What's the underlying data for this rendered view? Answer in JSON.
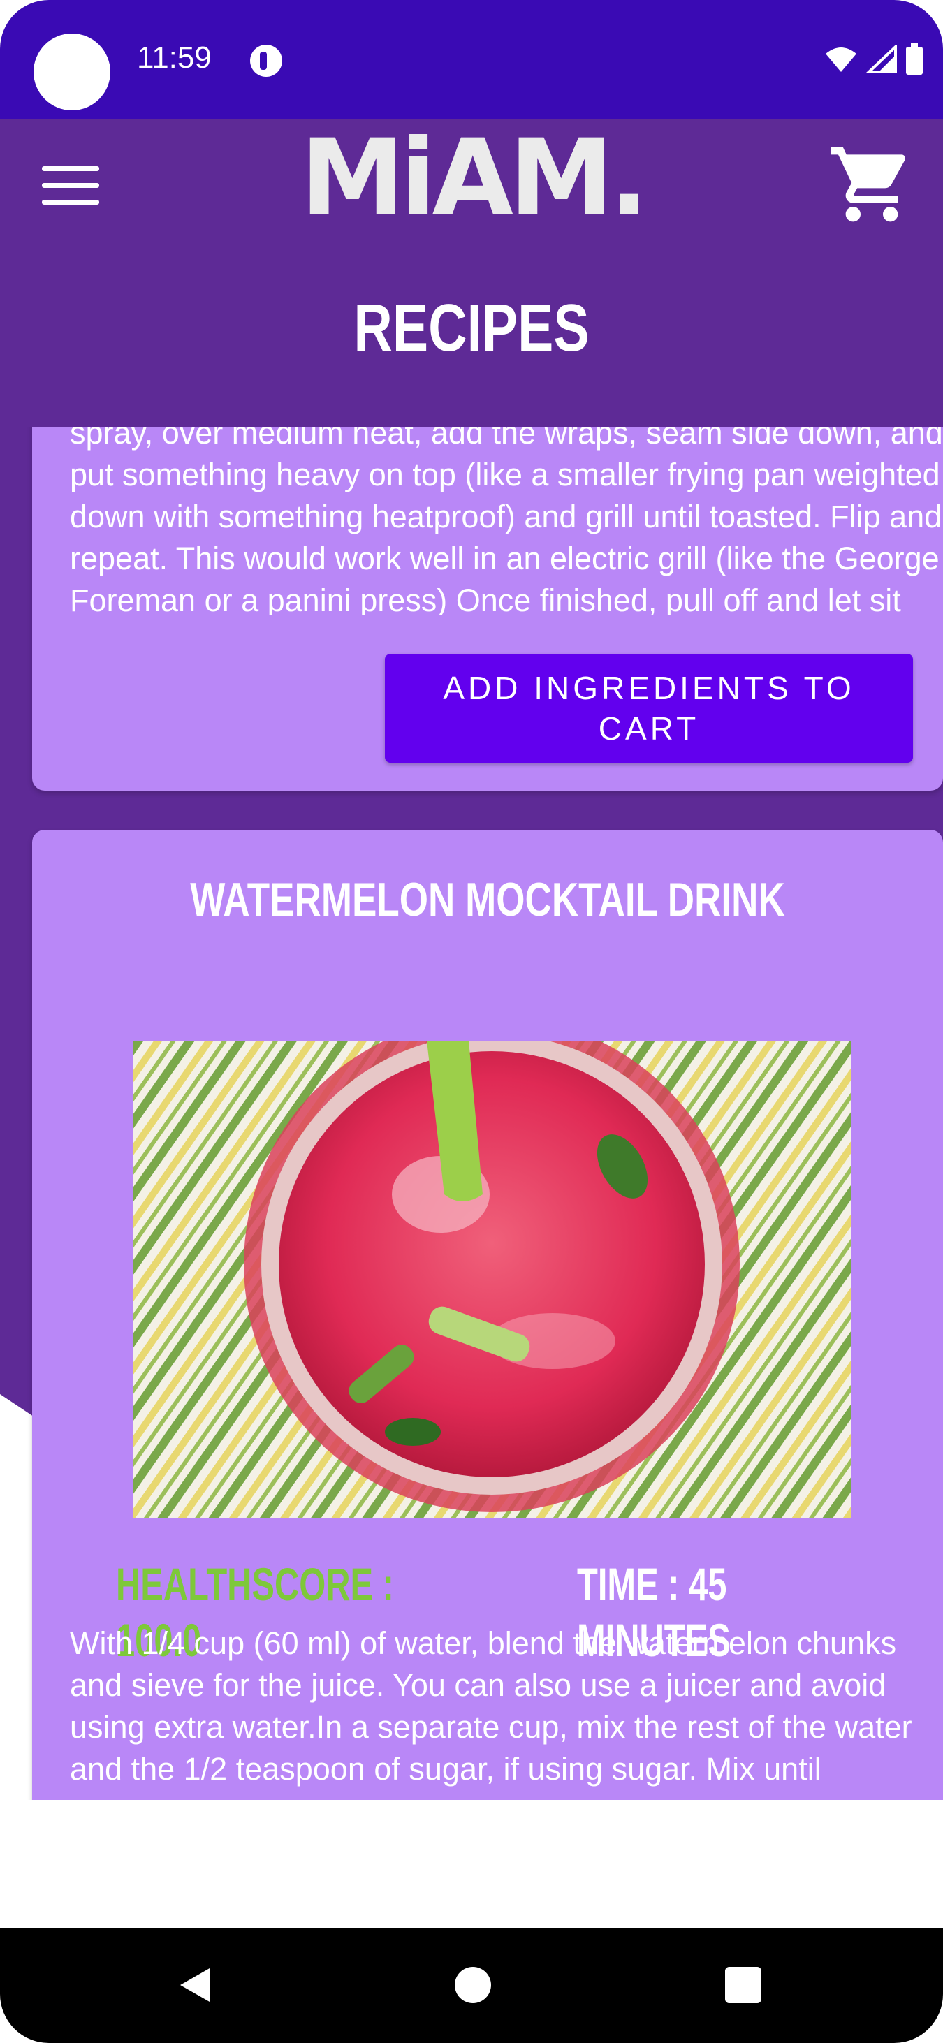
{
  "status_bar": {
    "time": "11:59",
    "icons": [
      "wifi-icon",
      "signal-icon",
      "battery-icon"
    ]
  },
  "header": {
    "logo_text": "MiAM.",
    "title": "RECIPES",
    "menu_icon": "hamburger-menu-icon",
    "cart_icon": "shopping-cart-icon"
  },
  "recipes": [
    {
      "instructions": "spray, over medium heat, add the wraps, seam side down, and put something heavy on top (like a smaller frying pan weighted down with something heatproof) and grill until toasted. Flip and repeat. This would work well in an electric grill (like the George Foreman or a panini press) Once finished, pull off and let sit for",
      "button_label": "ADD  INGREDIENTS TO CART"
    },
    {
      "title": "WATERMELON MOCKTAIL DRINK",
      "image_label": "watermelon mocktail photo",
      "healthscore": "HEALTHSCORE : 100.0",
      "time": "TIME : 45 MINUTES",
      "instructions": "With 1/4 cup (60 ml) of water, blend the watermelon chunks and sieve for the juice. You can also use a juicer and avoid using extra water.In a separate cup, mix the rest of the water and the 1/2 teaspoon of sugar, if using sugar. Mix until"
    }
  ],
  "colors": {
    "status_bar": "#3a0ab4",
    "header": "#5e2a96",
    "card": "#b987f7",
    "button": "#6200ee",
    "healthscore": "#7ec83a"
  },
  "nav": {
    "back_icon": "back-triangle-icon",
    "home_icon": "home-circle-icon",
    "recents_icon": "recents-square-icon"
  }
}
